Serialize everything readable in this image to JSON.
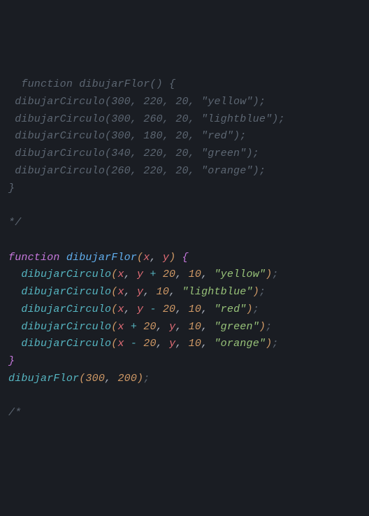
{
  "code": {
    "commented_block": {
      "line1_indent": "  ",
      "line1_text": "function dibujarFlor() {",
      "calls": [
        {
          "indent": " ",
          "fn": "dibujarCirculo",
          "args": "(300, 220, 20, \"yellow\");"
        },
        {
          "indent": " ",
          "fn": "dibujarCirculo",
          "args": "(300, 260, 20, \"lightblue\");"
        },
        {
          "indent": " ",
          "fn": "dibujarCirculo",
          "args": "(300, 180, 20, \"red\");"
        },
        {
          "indent": " ",
          "fn": "dibujarCirculo",
          "args": "(340, 220, 20, \"green\");"
        },
        {
          "indent": " ",
          "fn": "dibujarCirculo",
          "args": "(260, 220, 20, \"orange\");"
        }
      ],
      "close_brace": "}",
      "end_marker": "*/"
    },
    "active": {
      "kw_function": "function",
      "fn_name": "dibujarFlor",
      "param_x": "x",
      "param_y": "y",
      "calls": [
        {
          "fn": "dibujarCirculo",
          "a1": "x",
          "a2a": "y",
          "a2op": " + ",
          "a2b": "20",
          "a3": "10",
          "a4": "\"yellow\""
        },
        {
          "fn": "dibujarCirculo",
          "a1": "x",
          "a2a": "y",
          "a2op": "",
          "a2b": "",
          "a3": "10",
          "a4": "\"lightblue\""
        },
        {
          "fn": "dibujarCirculo",
          "a1": "x",
          "a2a": "y",
          "a2op": " - ",
          "a2b": "20",
          "a3": "10",
          "a4": "\"red\""
        },
        {
          "fn": "dibujarCirculo",
          "a1": "x",
          "a1op": " + ",
          "a1b": "20",
          "a2a": "y",
          "a2op": "",
          "a2b": "",
          "a3": "10",
          "a4": "\"green\""
        },
        {
          "fn": "dibujarCirculo",
          "a1": "x",
          "a1op": " - ",
          "a1b": "20",
          "a2a": "y",
          "a2op": "",
          "a2b": "",
          "a3": "10",
          "a4": "\"orange\""
        }
      ],
      "invoke": {
        "fn": "dibujarFlor",
        "arg1": "300",
        "arg2": "200"
      }
    },
    "trailing_comment": "/*"
  }
}
